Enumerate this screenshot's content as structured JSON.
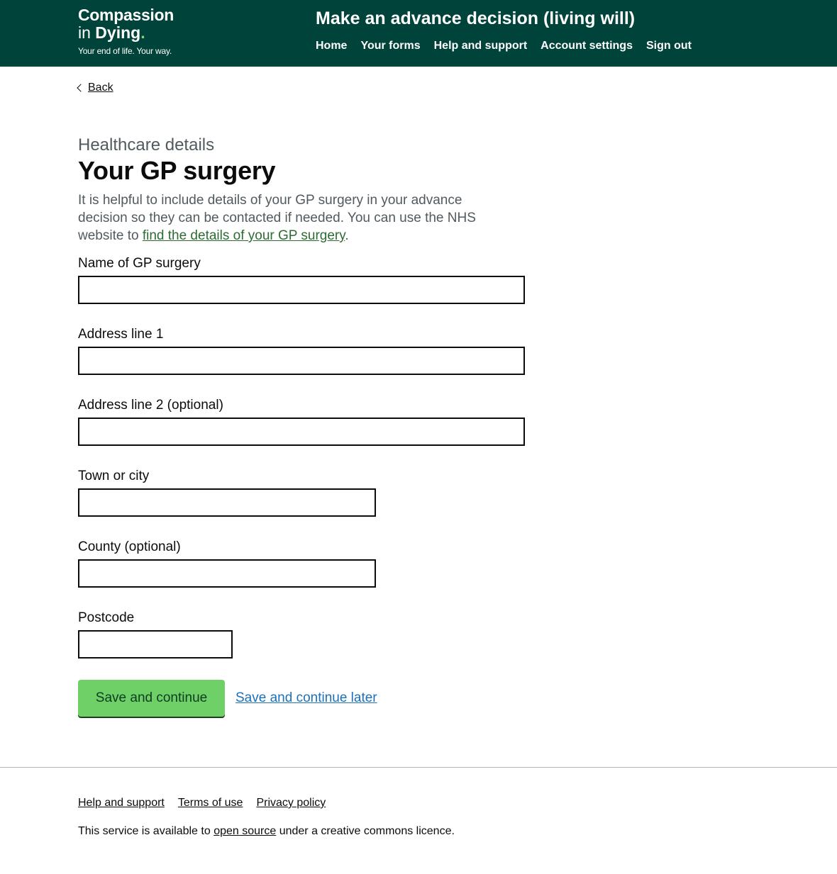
{
  "header": {
    "logo": {
      "line1": "Compassion",
      "line2_prefix": "in ",
      "line2_bold": "Dying",
      "dot": ".",
      "tagline": "Your end of life. Your way."
    },
    "service_name": "Make an advance decision (living will)",
    "nav": [
      "Home",
      "Your forms",
      "Help and support",
      "Account settings",
      "Sign out"
    ]
  },
  "back_link": "Back",
  "caption": "Healthcare details",
  "title": "Your GP surgery",
  "intro": {
    "text_before": "It is helpful to include details of your GP surgery in your advance decision so they can be contacted if needed. You can use the NHS website to ",
    "link_text": "find the details of your GP surgery",
    "text_after": "."
  },
  "fields": [
    {
      "label": "Name of GP surgery",
      "value": ""
    },
    {
      "label": "Address line 1",
      "value": ""
    },
    {
      "label": "Address line 2 (optional)",
      "value": ""
    },
    {
      "label": "Town or city",
      "value": ""
    },
    {
      "label": "County (optional)",
      "value": ""
    },
    {
      "label": "Postcode",
      "value": ""
    }
  ],
  "actions": {
    "save_continue": "Save and continue",
    "save_later": "Save and continue later"
  },
  "footer": {
    "links": [
      "Help and support",
      "Terms of use",
      "Privacy policy"
    ],
    "licence_before": "This service is available to ",
    "licence_link": "open source",
    "licence_after": " under a creative commons licence."
  },
  "colors": {
    "header_bg": "#00433b",
    "button_bg": "#70d068",
    "link_green": "#2e6b34",
    "link_blue": "#1d70b8"
  }
}
